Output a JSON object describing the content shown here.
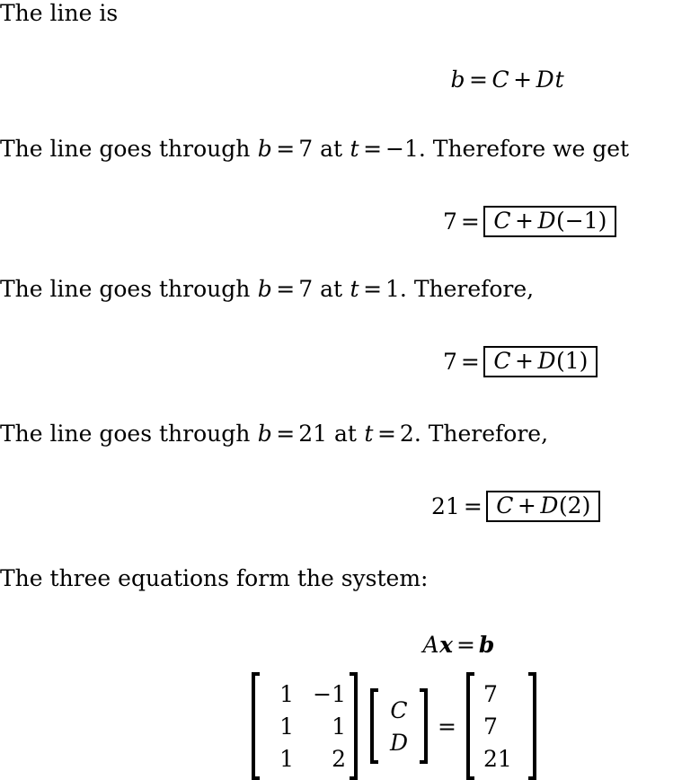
{
  "document": {
    "type": "latex-math-solution",
    "background_color": "#ffffff",
    "text_color": "#000000",
    "blocks": [
      {
        "id": "intro-line",
        "kind": "paragraph",
        "text": "The line is"
      },
      {
        "id": "line-equation",
        "kind": "display-equation",
        "text": "b = C + Dt",
        "parts": {
          "lhs": "b",
          "eq": "=",
          "term1": "C",
          "plus": "+",
          "term2": "D",
          "term3": "t"
        }
      },
      {
        "id": "point1-text",
        "kind": "paragraph",
        "text_plain": "The line goes through b = 7 at t = −1.  Therefore we get",
        "segments": {
          "s1": "The line goes through ",
          "var_b": "b",
          "eq1": "=",
          "val_b": "7",
          "s2": " at ",
          "var_t": "t",
          "eq2": "=",
          "val_t": "−1",
          "s3": ".  Therefore we get"
        }
      },
      {
        "id": "point1-equation",
        "kind": "boxed-equation",
        "lhs": "7",
        "eq": "=",
        "boxed": {
          "term1": "C",
          "plus": "+",
          "term2": "D",
          "arg": "(−1)"
        }
      },
      {
        "id": "point2-text",
        "kind": "paragraph",
        "text_plain": "The line goes through b = 7 at t = 1.  Therefore,",
        "segments": {
          "s1": "The line goes through ",
          "var_b": "b",
          "eq1": "=",
          "val_b": "7",
          "s2": " at ",
          "var_t": "t",
          "eq2": "=",
          "val_t": "1",
          "s3": ".  Therefore,"
        }
      },
      {
        "id": "point2-equation",
        "kind": "boxed-equation",
        "lhs": "7",
        "eq": "=",
        "boxed": {
          "term1": "C",
          "plus": "+",
          "term2": "D",
          "arg": "(1)"
        }
      },
      {
        "id": "point3-text",
        "kind": "paragraph",
        "text_plain": "The line goes through b = 21 at t = 2.  Therefore,",
        "segments": {
          "s1": "The line goes through ",
          "var_b": "b",
          "eq1": "=",
          "val_b": "21",
          "s2": " at ",
          "var_t": "t",
          "eq2": "=",
          "val_t": "2",
          "s3": ".  Therefore,"
        }
      },
      {
        "id": "point3-equation",
        "kind": "boxed-equation",
        "lhs": "21",
        "eq": "=",
        "boxed": {
          "term1": "C",
          "plus": "+",
          "term2": "D",
          "arg": "(2)"
        }
      },
      {
        "id": "system-text",
        "kind": "paragraph",
        "text": "The three equations form the system:"
      },
      {
        "id": "axb-equation",
        "kind": "display-equation",
        "parts": {
          "A": "A",
          "x": "x",
          "eq": "=",
          "b": "b"
        }
      },
      {
        "id": "matrix-equation",
        "kind": "matrix-equation",
        "matrix_A": {
          "rows": 3,
          "cols": 2,
          "values": [
            [
              "1",
              "−1"
            ],
            [
              "1",
              "1"
            ],
            [
              "1",
              "2"
            ]
          ]
        },
        "vector_x": {
          "rows": 2,
          "values": [
            "C",
            "D"
          ]
        },
        "equals": "=",
        "vector_b": {
          "rows": 3,
          "values": [
            "7",
            "7",
            "21"
          ]
        }
      }
    ]
  }
}
